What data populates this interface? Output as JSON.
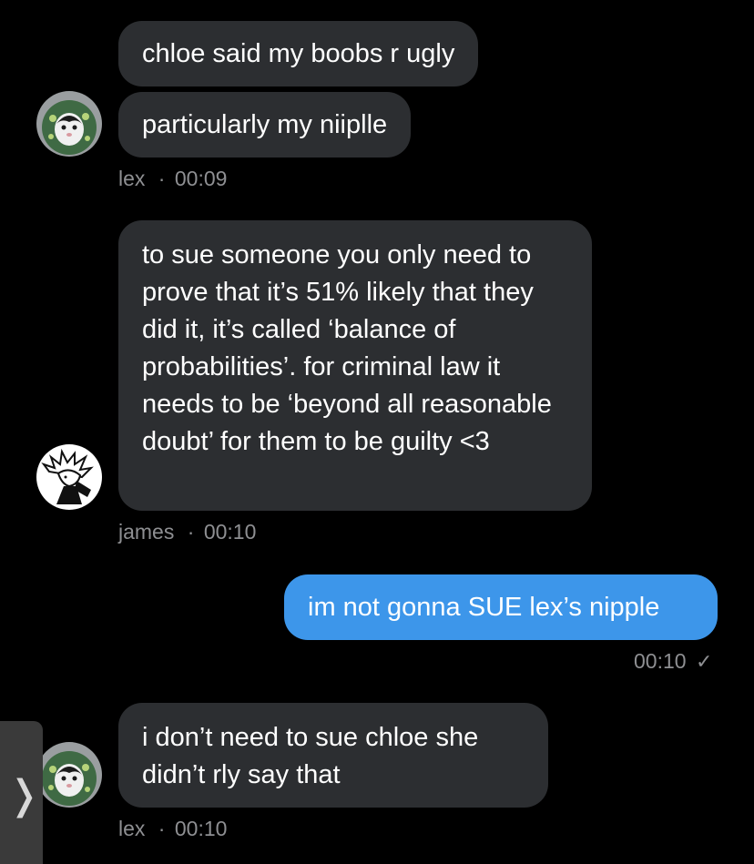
{
  "messages": [
    {
      "sender": "lex",
      "bubbles": [
        "chloe said my boobs r ugly",
        "particularly my niiplle"
      ],
      "time": "00:09",
      "avatar_icon": "cat-avatar-icon"
    },
    {
      "sender": "james",
      "bubbles": [
        "to sue someone you only need to prove that it’s 51% likely that they did it, it’s called ‘balance of probabilities’. for criminal law it needs to be ‘beyond all reasonable doubt’ for them to be guilty <3"
      ],
      "time": "00:10",
      "avatar_icon": "anime-character-avatar-icon"
    },
    {
      "sender": "me",
      "bubbles": [
        "im not gonna SUE lex’s nipple"
      ],
      "time": "00:10",
      "status_icon": "check-icon",
      "status_glyph": "✓"
    },
    {
      "sender": "lex",
      "bubbles": [
        "i don’t need to sue chloe she didn’t rly say that"
      ],
      "time": "00:10",
      "avatar_icon": "cat-avatar-icon"
    }
  ],
  "meta_separator": "·",
  "side_handle": {
    "icon": "chevron-right-icon",
    "glyph": "❭"
  },
  "colors": {
    "background": "#000000",
    "incoming_bubble": "#2c2e31",
    "outgoing_bubble": "#3d96ea",
    "meta_text": "#8e8f92"
  }
}
